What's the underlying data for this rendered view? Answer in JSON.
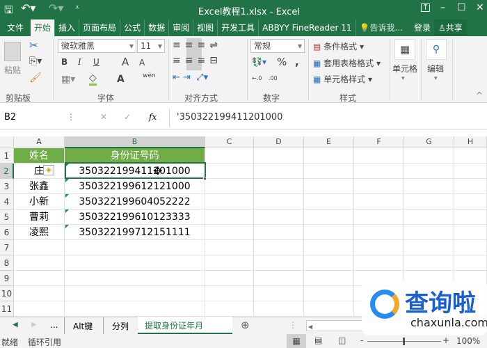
{
  "title": "Excel教程1.xlsx - Excel",
  "qat": {
    "save_icon": "save-icon",
    "undo_icon": "undo-icon",
    "redo_icon": "redo-icon"
  },
  "window": {
    "restore": "ribbon-display-icon",
    "min": "–",
    "max": "☐",
    "close": "✕"
  },
  "tabs": [
    "文件",
    "开始",
    "插入",
    "页面布局",
    "公式",
    "数据",
    "审阅",
    "视图",
    "开发工具",
    "ABBYY FineReader 11"
  ],
  "tell_me": "告诉我...",
  "login": "登录",
  "share": "共享",
  "ribbon": {
    "clipboard": {
      "paste": "粘贴",
      "label": "剪贴板"
    },
    "font": {
      "name": "微软雅黑",
      "size": "11",
      "bold": "B",
      "italic": "I",
      "underline": "U",
      "grow": "A",
      "shrink": "A",
      "color": "A",
      "phonetic": "wén",
      "label": "字体"
    },
    "align": {
      "label": "对齐方式"
    },
    "number": {
      "format": "常规",
      "percent": "%",
      "comma": ",",
      "inc": "←.0",
      "dec": ".00",
      "label": "数字"
    },
    "styles": {
      "conditional": "条件格式",
      "table": "套用表格格式",
      "cell": "单元格样式",
      "label": "样式"
    },
    "cells": {
      "label": "单元格"
    },
    "edit": {
      "label": "编辑"
    }
  },
  "formula_bar": {
    "name_box": "B2",
    "cancel": "✕",
    "enter": "✓",
    "fx": "fx",
    "value": "'350322199411201000"
  },
  "columns": [
    "A",
    "B",
    "C",
    "D",
    "E",
    "F",
    "G",
    "H"
  ],
  "rows": [
    "1",
    "2",
    "3",
    "4",
    "5",
    "6",
    "7",
    "8",
    "9",
    "10",
    "11"
  ],
  "table": {
    "headers": [
      "姓名",
      "身份证号码"
    ],
    "data": [
      [
        "庄",
        "350322199411201000"
      ],
      [
        "张鑫",
        "350322199612121000"
      ],
      [
        "小新",
        "350322199604052222"
      ],
      [
        "曹莉",
        "350322199610123333"
      ],
      [
        "凌熙",
        "350322199712151111"
      ]
    ]
  },
  "header_fill": "#70ad47",
  "accent": "#217346",
  "sheet_tabs": [
    "...",
    "Alt键",
    "分列",
    "提取身份证年月"
  ],
  "active_sheet": "提取身份证年月",
  "status": {
    "ready": "就绪",
    "circular": "循环引用",
    "zoom": "100%"
  },
  "watermark": {
    "text": "查询啦",
    "url_text": "chaxunla.com"
  }
}
